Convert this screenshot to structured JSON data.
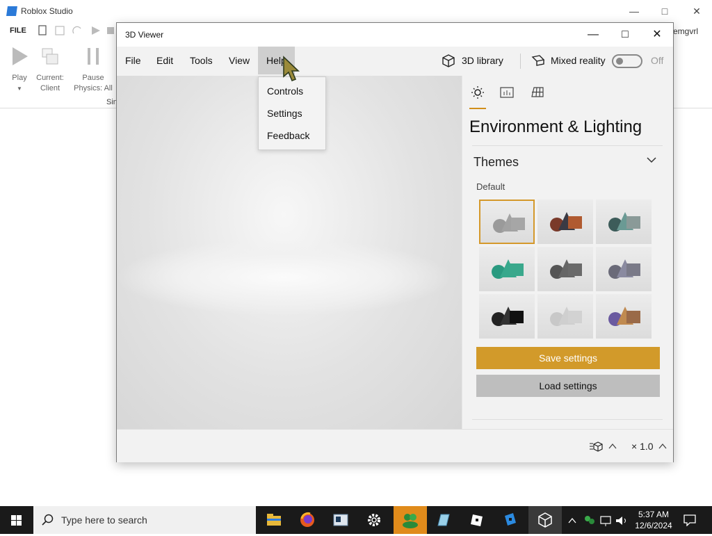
{
  "studio": {
    "title": "Roblox Studio",
    "file_menu": "FILE",
    "user": "emgvrl",
    "ribbon": {
      "play": "Play",
      "current_line1": "Current:",
      "current_line2": "Client",
      "pause_line1": "Pause",
      "pause_line2": "Physics: All",
      "group_label": "Sin"
    }
  },
  "viewer": {
    "title": "3D Viewer",
    "menu": [
      "File",
      "Edit",
      "Tools",
      "View",
      "Help"
    ],
    "library_label": "3D library",
    "mixed_reality_label": "Mixed reality",
    "toggle_state": "Off",
    "help_menu": [
      "Controls",
      "Settings",
      "Feedback"
    ],
    "panel": {
      "heading": "Environment & Lighting",
      "themes_label": "Themes",
      "default_label": "Default",
      "save_button": "Save settings",
      "load_button": "Load settings"
    },
    "zoom_label": "× 1.0"
  },
  "taskbar": {
    "search_placeholder": "Type here to search",
    "time": "5:37 AM",
    "date": "12/6/2024"
  },
  "colors": {
    "accent": "#d29a2a",
    "taskbar": "#1a1a1a",
    "active_app": "#e08b1b"
  }
}
